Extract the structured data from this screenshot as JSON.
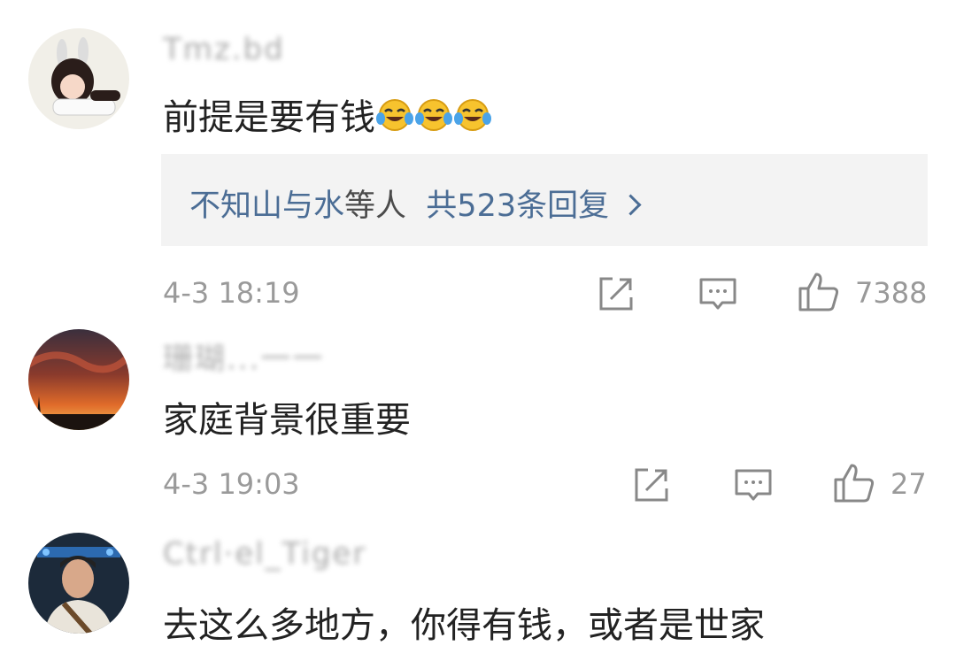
{
  "comments": [
    {
      "username": "Tmz.bd",
      "text": "前提是要有钱",
      "emoji": [
        "crying-laughing-emoji",
        "crying-laughing-emoji",
        "crying-laughing-emoji"
      ],
      "replies": {
        "users": "不知山与水",
        "mid": "等人",
        "count_text": "共523条回复"
      },
      "time": "4-3 18:19",
      "likes": "7388"
    },
    {
      "username": "珊瑚...一一",
      "text": "家庭背景很重要",
      "time": "4-3 19:03",
      "likes": "27"
    },
    {
      "username": "Ctrl·el_Tiger",
      "text": "去这么多地方，你得有钱，或者是世家"
    }
  ],
  "icons": {
    "share": "share-icon",
    "comment": "comment-icon",
    "like": "thumbs-up-icon"
  },
  "colors": {
    "link": "#4b6d95",
    "meta": "#9a9a9a",
    "reply_bg": "#f3f3f3"
  }
}
